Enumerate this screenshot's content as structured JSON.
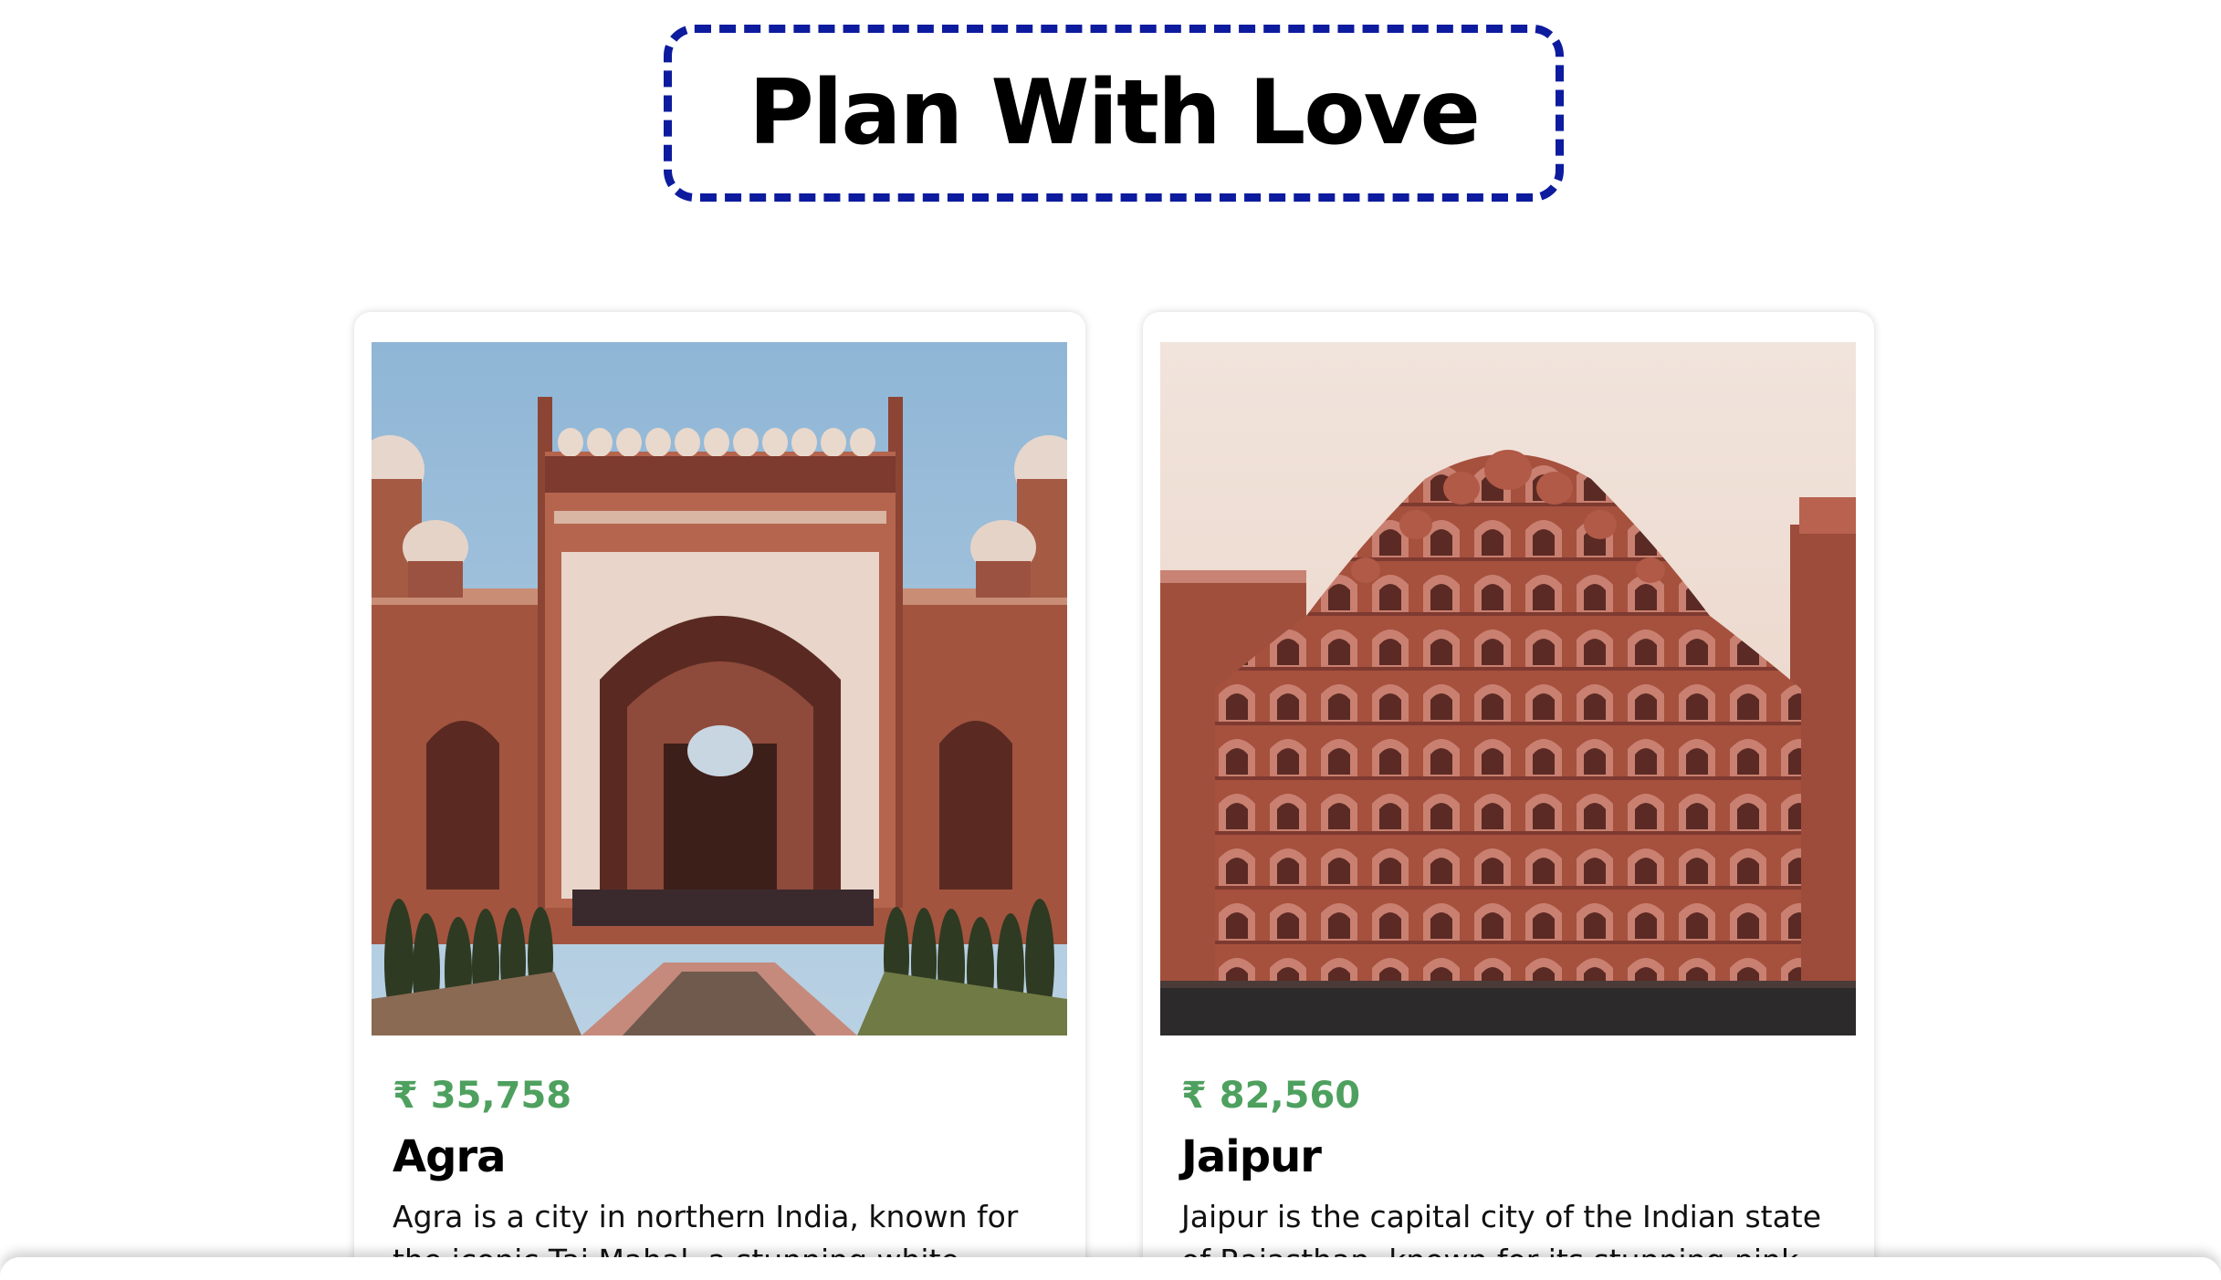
{
  "header": {
    "title": "Plan With Love"
  },
  "tours": [
    {
      "price": "₹ 35,758",
      "name": "Agra",
      "description": "Agra is a city in northern India, known for the iconic Taj Mahal, a stunning white marble"
    },
    {
      "price": "₹ 82,560",
      "name": "Jaipur",
      "description": "Jaipur is the capital city of the Indian state of Rajasthan, known for its stunning pink-"
    }
  ],
  "colors": {
    "title_border": "#0d1b9e",
    "price": "#4ea05f",
    "text": "#000000",
    "background": "#ffffff"
  }
}
